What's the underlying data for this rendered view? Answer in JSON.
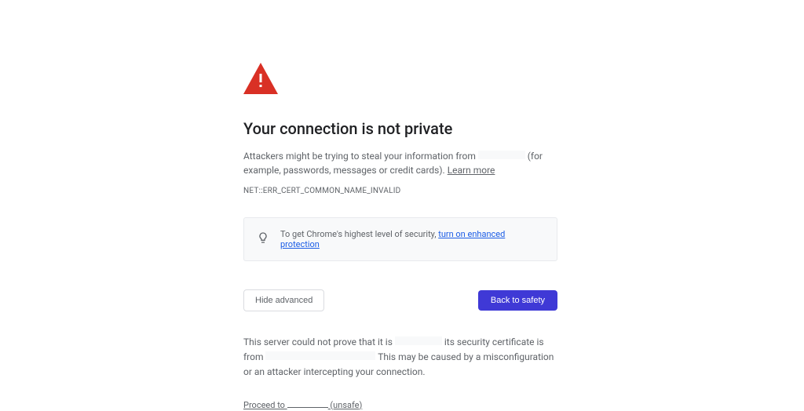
{
  "icon": {
    "color": "#d93025"
  },
  "heading": "Your connection is not private",
  "description": {
    "prefix": "Attackers might be trying to steal your information from ",
    "suffix": " (for example, passwords, messages or credit cards). ",
    "learn_more": "Learn more"
  },
  "error_code": "NET::ERR_CERT_COMMON_NAME_INVALID",
  "infobox": {
    "text_prefix": "To get Chrome's highest level of security, ",
    "link": "turn on enhanced protection"
  },
  "buttons": {
    "hide_advanced": "Hide advanced",
    "back_to_safety": "Back to safety"
  },
  "details": {
    "part1": "This server could not prove that it is ",
    "part2": " its security certificate is from ",
    "part3": " This may be caused by a misconfiguration or an attacker intercepting your connection."
  },
  "proceed": {
    "prefix": "Proceed to ",
    "suffix": " (unsafe)"
  }
}
